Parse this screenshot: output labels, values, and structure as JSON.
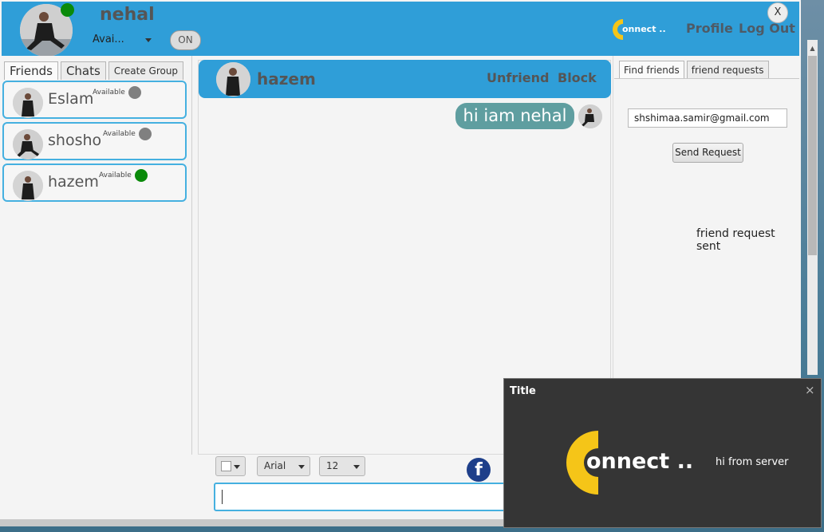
{
  "header": {
    "user_name": "nehal",
    "status_value": "Avai...",
    "toggle_label": "ON",
    "logo_text": "onnect ..",
    "profile_label": "Profile",
    "logout_label": "Log Out",
    "close_label": "X",
    "status_color": "#0a8a0a"
  },
  "left_tabs": {
    "friends": "Friends",
    "chats": "Chats",
    "create_group": "Create Group"
  },
  "friends": [
    {
      "name": "Eslam",
      "status": "Available",
      "dot_color": "#808080"
    },
    {
      "name": "shosho",
      "status": "Available",
      "dot_color": "#808080"
    },
    {
      "name": "hazem",
      "status": "Available",
      "dot_color": "#0a8a0a"
    }
  ],
  "chat": {
    "partner_name": "hazem",
    "unfriend_label": "Unfriend",
    "block_label": "Block",
    "message": "hi iam nehal",
    "font_value": "Arial",
    "size_value": "12",
    "fb_icon": "f",
    "accent_color": "#2f9ed8",
    "bubble_color": "#5f9ea0"
  },
  "right_tabs": {
    "find_friends": "Find friends",
    "friend_requests": "friend requests"
  },
  "find": {
    "email_value": "shshimaa.samir@gmail.com",
    "send_label": "Send Request",
    "status_text": "friend request sent"
  },
  "notification": {
    "title": "Title",
    "close_label": "×",
    "logo_text": "onnect ..",
    "message": "hi from server",
    "logo_color": "#f5c518"
  }
}
